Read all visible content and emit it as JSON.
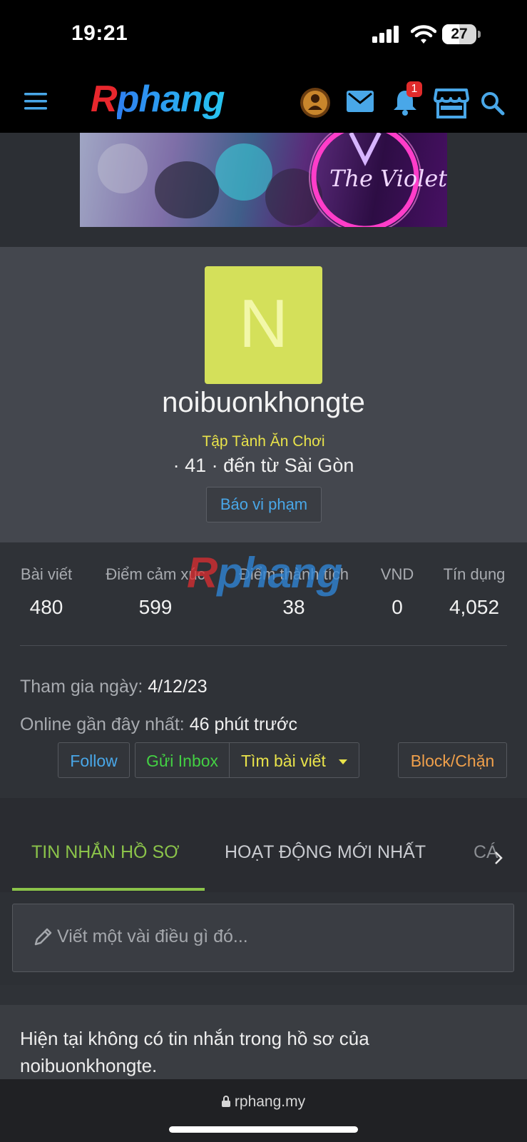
{
  "status_bar": {
    "time": "19:21",
    "battery": "27"
  },
  "header": {
    "logo_r": "R",
    "logo_rest": "phang",
    "notification_count": "1"
  },
  "profile": {
    "avatar_letter": "N",
    "username": "noibuonkhongte",
    "user_title": "Tập Tành Ăn Chơi",
    "meta": "· 41 · đến từ Sài Gòn",
    "report_label": "Báo vi phạm"
  },
  "stats": [
    {
      "label": "Bài viết",
      "value": "480"
    },
    {
      "label": "Điểm cảm xúc",
      "value": "599"
    },
    {
      "label": "Điểm thành tích",
      "value": "38"
    },
    {
      "label": "VND",
      "value": "0"
    },
    {
      "label": "Tín dụng",
      "value": "4,052"
    }
  ],
  "watermark": {
    "r": "R",
    "rest": "phang"
  },
  "info": {
    "joined_label": "Tham gia ngày:",
    "joined_value": "4/12/23",
    "online_label": "Online gần đây nhất:",
    "online_value": "46 phút trước"
  },
  "actions": {
    "follow": "Follow",
    "inbox": "Gửi Inbox",
    "find_posts": "Tìm bài viết",
    "block": "Block/Chặn"
  },
  "tabs": [
    {
      "label": "TIN NHẮN HỒ SƠ"
    },
    {
      "label": "HOẠT ĐỘNG MỚI NHẤT"
    },
    {
      "label": "CÁ"
    }
  ],
  "composer": {
    "placeholder": "Viết một vài điều gì đó..."
  },
  "empty_message": "Hiện tại không có tin nhắn trong hồ sơ của noibuonkhongte.",
  "url_bar": {
    "url": "rphang.my"
  },
  "colors": {
    "accent_blue": "#49a7e8",
    "tab_active": "#8bc34a",
    "title_yellow": "#e9e34a",
    "block_orange": "#f0a04b",
    "inbox_green": "#43d043",
    "avatar_bg": "#d4e05a"
  }
}
